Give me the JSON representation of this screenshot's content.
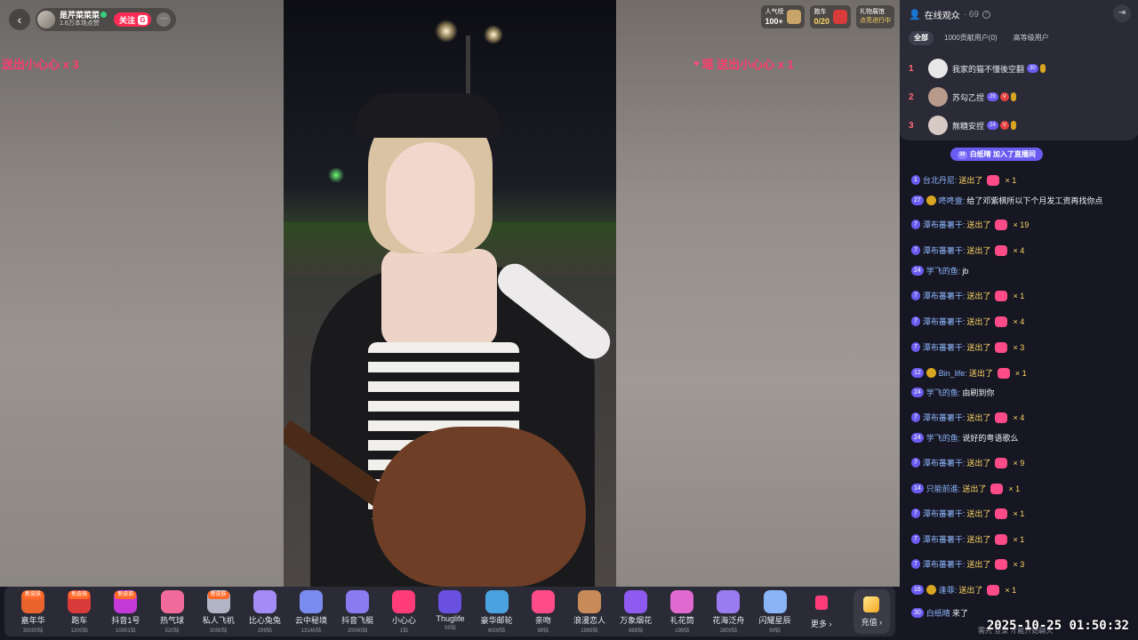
{
  "anchor": {
    "name": "是芹菜菜菜",
    "viewers_line": "1.6万本场点赞",
    "follow_label": "关注",
    "follow_badge": "G",
    "more_label": "···",
    "back_icon": "back-arrow-icon"
  },
  "stats": {
    "popularity_label": "人气榜",
    "popularity_value": "100+",
    "car_label": "跑车",
    "car_value": "0/20",
    "wish_label": "礼物展馆",
    "wish_value": "点亮进行中"
  },
  "toasts": {
    "left": "送出小心心 x 3",
    "right": "瑶 送出小心心 x 1"
  },
  "gifts": [
    {
      "name": "嘉年华",
      "price": "30000钻",
      "tag": "新皮肤",
      "color": "#e8642c"
    },
    {
      "name": "跑车",
      "price": "1200钻",
      "tag": "新皮肤",
      "color": "#d93a3a"
    },
    {
      "name": "抖音1号",
      "price": "10001钻",
      "tag": "新皮肤",
      "color": "#c43ad9"
    },
    {
      "name": "热气球",
      "price": "520钻",
      "tag": "",
      "color": "#f06a9a"
    },
    {
      "name": "私人飞机",
      "price": "3000钻",
      "tag": "新皮肤",
      "color": "#b0b4c4"
    },
    {
      "name": "比心兔兔",
      "price": "299钻",
      "tag": "",
      "color": "#a38cf5"
    },
    {
      "name": "云中秘境",
      "price": "13140钻",
      "tag": "",
      "color": "#7b8cf0"
    },
    {
      "name": "抖音飞艇",
      "price": "20000钻",
      "tag": "",
      "color": "#8a7cf0"
    },
    {
      "name": "小心心",
      "price": "1钻",
      "tag": "",
      "color": "#ff3c7a"
    },
    {
      "name": "Thuglife",
      "price": "99钻",
      "tag": "",
      "color": "#6a50e0"
    },
    {
      "name": "豪华邮轮",
      "price": "6000钻",
      "tag": "",
      "color": "#4aa3e0"
    },
    {
      "name": "亲吻",
      "price": "99钻",
      "tag": "",
      "color": "#ff4b87"
    },
    {
      "name": "浪漫恋人",
      "price": "1999钻",
      "tag": "",
      "color": "#c98a5a"
    },
    {
      "name": "万象烟花",
      "price": "688钻",
      "tag": "",
      "color": "#8e5af0"
    },
    {
      "name": "礼花筒",
      "price": "199钻",
      "tag": "",
      "color": "#e06ad0"
    },
    {
      "name": "花海泛舟",
      "price": "2800钻",
      "tag": "",
      "color": "#9a7cf0"
    },
    {
      "name": "闪耀星辰",
      "price": "99钻",
      "tag": "",
      "color": "#8ab4f8"
    }
  ],
  "gift_more_label": "更多 ›",
  "recharge_label": "充值 ›",
  "panel": {
    "title": "在线观众",
    "count": "· 69",
    "tabs": [
      "全部",
      "1000贡献用户(0)",
      "高等级用户"
    ],
    "ranking": [
      {
        "rank": "1",
        "name": "我家的猫不懂後空翻",
        "level": "30"
      },
      {
        "rank": "2",
        "name": "苏勾乙捏",
        "level": "29"
      },
      {
        "rank": "3",
        "name": "無糖安捏",
        "level": "24"
      }
    ],
    "join_notice": {
      "level": "30",
      "text": "白纸晴 加入了直播间"
    }
  },
  "chat": [
    {
      "level": "1",
      "user": "台北丹尼:",
      "action": "送出了",
      "gift": true,
      "mult": "× 1",
      "text": ""
    },
    {
      "level": "27",
      "user": "咚咚壹:",
      "action": "",
      "gift": false,
      "mult": "",
      "text": "给了邓紫棋所以下个月发工资再找你点",
      "fan": true
    },
    {
      "level": "7",
      "user": "潭布蕃薯干:",
      "action": "送出了",
      "gift": true,
      "mult": "× 19",
      "text": ""
    },
    {
      "level": "7",
      "user": "潭布蕃薯干:",
      "action": "送出了",
      "gift": true,
      "mult": "× 4",
      "text": ""
    },
    {
      "level": "24",
      "user": "学飞的鱼:",
      "action": "",
      "gift": false,
      "mult": "",
      "text": "jb"
    },
    {
      "level": "7",
      "user": "潭布蕃薯干:",
      "action": "送出了",
      "gift": true,
      "mult": "× 1",
      "text": ""
    },
    {
      "level": "7",
      "user": "潭布蕃薯干:",
      "action": "送出了",
      "gift": true,
      "mult": "× 4",
      "text": ""
    },
    {
      "level": "7",
      "user": "潭布蕃薯干:",
      "action": "送出了",
      "gift": true,
      "mult": "× 3",
      "text": ""
    },
    {
      "level": "12",
      "user": "Bin_life:",
      "action": "送出了",
      "gift": true,
      "mult": "× 1",
      "text": "",
      "fan": true
    },
    {
      "level": "24",
      "user": "学飞的鱼:",
      "action": "",
      "gift": false,
      "mult": "",
      "text": "由刷到你"
    },
    {
      "level": "7",
      "user": "潭布蕃薯干:",
      "action": "送出了",
      "gift": true,
      "mult": "× 4",
      "text": ""
    },
    {
      "level": "24",
      "user": "学飞的鱼:",
      "action": "",
      "gift": false,
      "mult": "",
      "text": "说好的粤语歌么"
    },
    {
      "level": "7",
      "user": "潭布蕃薯干:",
      "action": "送出了",
      "gift": true,
      "mult": "× 9",
      "text": ""
    },
    {
      "level": "14",
      "user": "只能前進:",
      "action": "送出了",
      "gift": true,
      "mult": "× 1",
      "text": ""
    },
    {
      "level": "7",
      "user": "潭布蕃薯干:",
      "action": "送出了",
      "gift": true,
      "mult": "× 1",
      "text": ""
    },
    {
      "level": "7",
      "user": "潭布蕃薯干:",
      "action": "送出了",
      "gift": true,
      "mult": "× 1",
      "text": ""
    },
    {
      "level": "7",
      "user": "潭布蕃薯干:",
      "action": "送出了",
      "gift": true,
      "mult": "× 3",
      "text": ""
    },
    {
      "level": "16",
      "user": "逢菲:",
      "action": "送出了",
      "gift": true,
      "mult": "× 1",
      "text": "",
      "fan": true
    },
    {
      "level": "30",
      "user": "白纸晴",
      "action": "",
      "gift": false,
      "mult": "",
      "text": "来了"
    }
  ],
  "footer_hint": "需先 登录 才能开始聊天",
  "timestamp": "2025-10-25 01:50:32"
}
